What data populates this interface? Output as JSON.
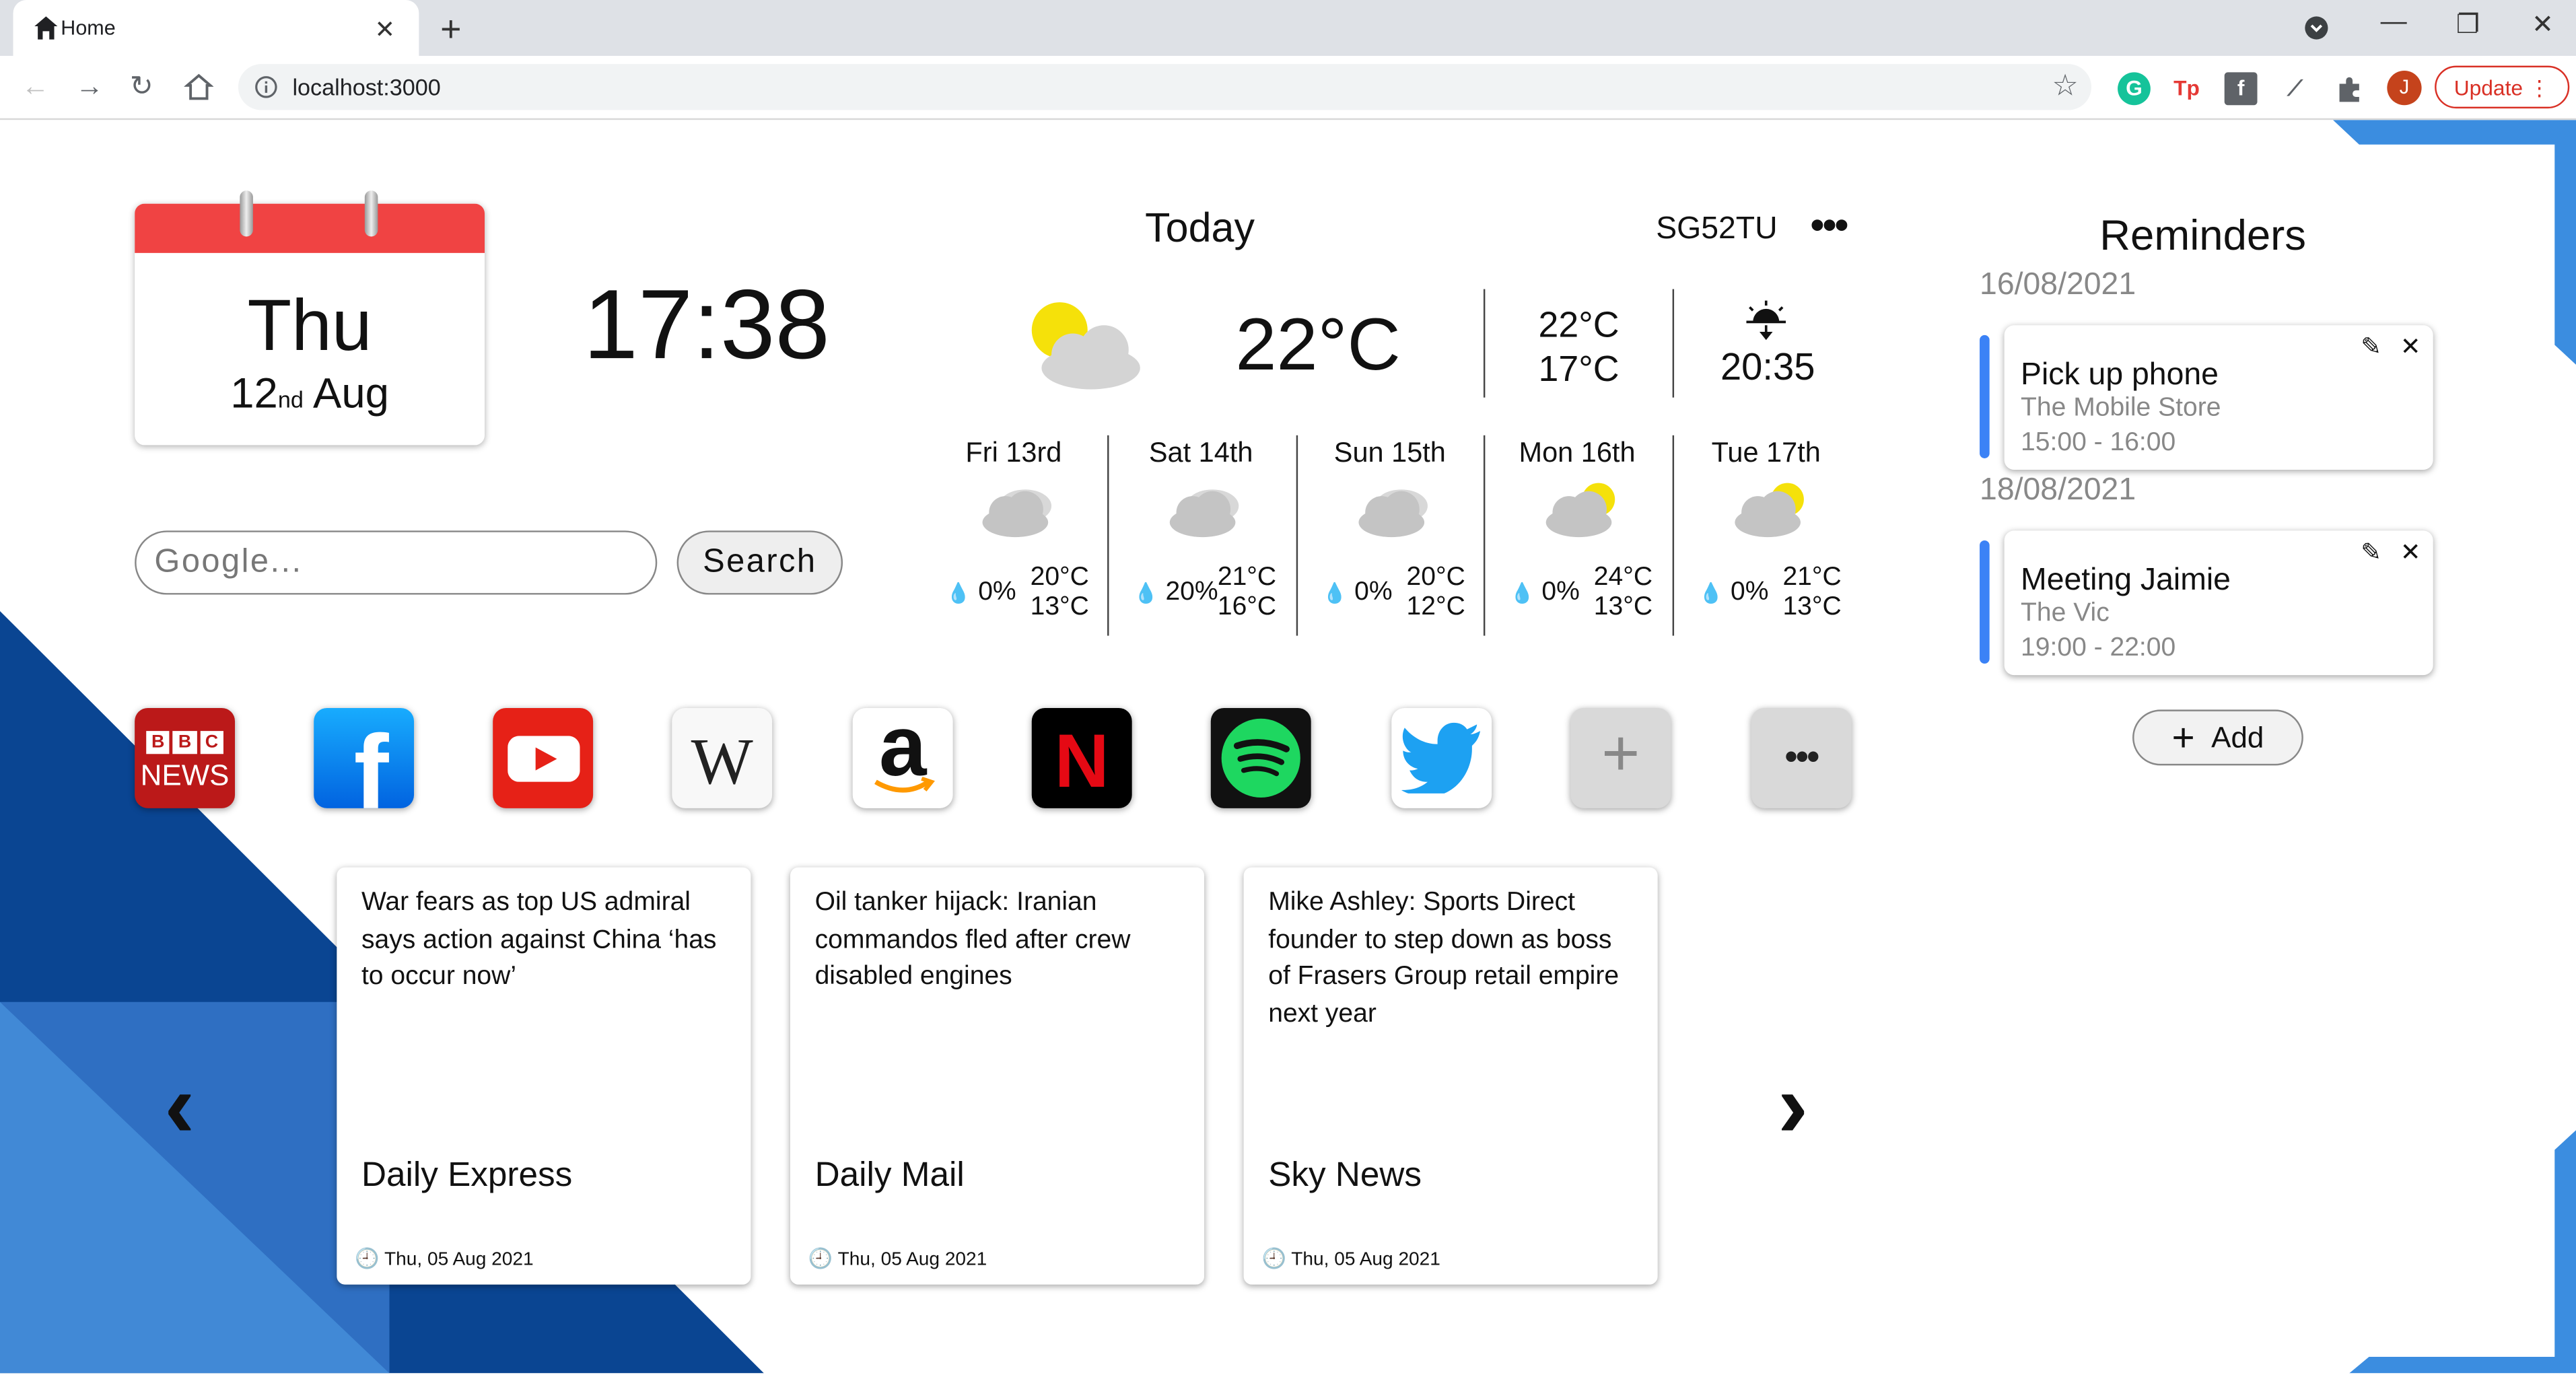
{
  "browser": {
    "tab_title": "Home",
    "url": "localhost:3000",
    "update_label": "Update",
    "profile_initial": "J"
  },
  "calendar": {
    "day": "Thu",
    "date_num": "12",
    "date_suffix": "nd",
    "month": "Aug"
  },
  "clock": {
    "time": "17:38"
  },
  "search": {
    "placeholder": "Google...",
    "button_label": "Search"
  },
  "weather": {
    "title": "Today",
    "location": "SG52TU",
    "more_label": "•••",
    "temp": "22°C",
    "high": "22°C",
    "low": "17°C",
    "sunset": "20:35",
    "forecast": [
      {
        "day": "Fri 13rd",
        "rain": "0%",
        "high": "20°C",
        "low": "13°C",
        "icon": "cloud-icon"
      },
      {
        "day": "Sat 14th",
        "rain": "20%",
        "high": "21°C",
        "low": "16°C",
        "icon": "cloud-icon"
      },
      {
        "day": "Sun 15th",
        "rain": "0%",
        "high": "20°C",
        "low": "12°C",
        "icon": "cloud-icon"
      },
      {
        "day": "Mon 16th",
        "rain": "0%",
        "high": "24°C",
        "low": "13°C",
        "icon": "partly-sunny-icon"
      },
      {
        "day": "Tue 17th",
        "rain": "0%",
        "high": "21°C",
        "low": "13°C",
        "icon": "partly-sunny-icon"
      }
    ]
  },
  "shortcuts": [
    {
      "name": "BBC News",
      "line1": "BBC",
      "line2": "NEWS"
    },
    {
      "name": "Facebook",
      "glyph": "f"
    },
    {
      "name": "YouTube"
    },
    {
      "name": "Wikipedia",
      "glyph": "W"
    },
    {
      "name": "Amazon",
      "glyph": "a"
    },
    {
      "name": "Netflix",
      "glyph": "N"
    },
    {
      "name": "Spotify"
    },
    {
      "name": "Twitter"
    },
    {
      "name": "Add shortcut",
      "glyph": "+"
    },
    {
      "name": "More",
      "glyph": "•••"
    }
  ],
  "news": [
    {
      "headline": "War fears as top US admiral says action against China ‘has to occur now’",
      "source": "Daily Express",
      "date": "Thu, 05 Aug 2021"
    },
    {
      "headline": "Oil tanker hijack: Iranian commandos fled after crew disabled engines",
      "source": "Daily Mail",
      "date": "Thu, 05 Aug 2021"
    },
    {
      "headline": "Mike Ashley: Sports Direct founder to step down as boss of Frasers Group retail empire next year",
      "source": "Sky News",
      "date": "Thu, 05 Aug 2021"
    }
  ],
  "reminders": {
    "title": "Reminders",
    "groups": [
      {
        "date": "16/08/2021",
        "name": "Pick up phone",
        "place": "The Mobile Store",
        "time": "15:00 - 16:00"
      },
      {
        "date": "18/08/2021",
        "name": "Meeting Jaimie",
        "place": "The Vic",
        "time": "19:00 - 22:00"
      }
    ],
    "add_label": "Add"
  },
  "colors": {
    "brand_blue": "#0a4592",
    "accent_blue": "#3b82f6",
    "calendar_red": "#f04343",
    "update_red": "#d93025"
  }
}
